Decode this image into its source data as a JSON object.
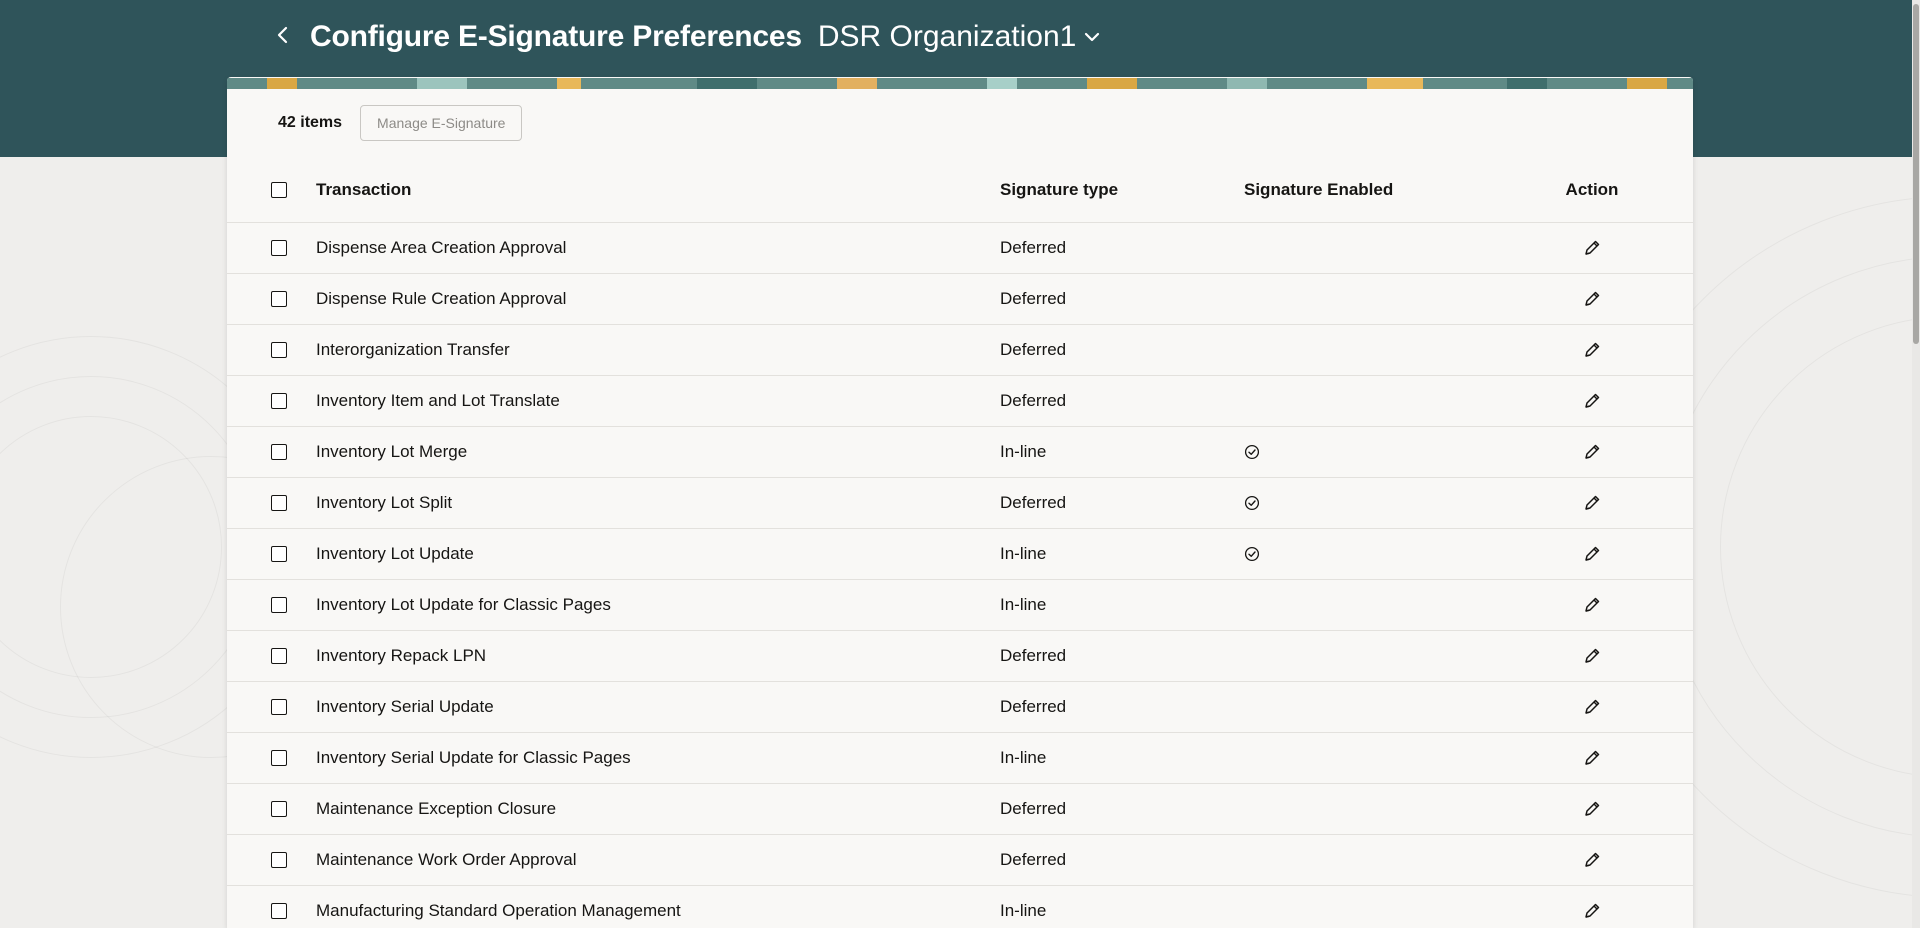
{
  "header": {
    "back_label": "Back",
    "title": "Configure E-Signature Preferences",
    "organization": "DSR Organization1",
    "colors": {
      "band": "#2f545a",
      "title_text": "#ffffff"
    }
  },
  "toolbar": {
    "items_count": "42 items",
    "manage_label": "Manage E-Signature"
  },
  "table": {
    "columns": {
      "transaction": "Transaction",
      "signature_type": "Signature type",
      "signature_enabled": "Signature Enabled",
      "action": "Action"
    },
    "rows": [
      {
        "transaction": "Dispense Area Creation Approval",
        "signature_type": "Deferred",
        "enabled": false
      },
      {
        "transaction": "Dispense Rule Creation Approval",
        "signature_type": "Deferred",
        "enabled": false
      },
      {
        "transaction": "Interorganization Transfer",
        "signature_type": "Deferred",
        "enabled": false
      },
      {
        "transaction": "Inventory Item and Lot Translate",
        "signature_type": "Deferred",
        "enabled": false
      },
      {
        "transaction": "Inventory Lot Merge",
        "signature_type": "In-line",
        "enabled": true
      },
      {
        "transaction": "Inventory Lot Split",
        "signature_type": "Deferred",
        "enabled": true
      },
      {
        "transaction": "Inventory Lot Update",
        "signature_type": "In-line",
        "enabled": true
      },
      {
        "transaction": "Inventory Lot Update for Classic Pages",
        "signature_type": "In-line",
        "enabled": false
      },
      {
        "transaction": "Inventory Repack LPN",
        "signature_type": "Deferred",
        "enabled": false
      },
      {
        "transaction": "Inventory Serial Update",
        "signature_type": "Deferred",
        "enabled": false
      },
      {
        "transaction": "Inventory Serial Update for Classic Pages",
        "signature_type": "In-line",
        "enabled": false
      },
      {
        "transaction": "Maintenance Exception Closure",
        "signature_type": "Deferred",
        "enabled": false
      },
      {
        "transaction": "Maintenance Work Order Approval",
        "signature_type": "Deferred",
        "enabled": false
      },
      {
        "transaction": "Manufacturing Standard Operation Management",
        "signature_type": "In-line",
        "enabled": false
      }
    ]
  },
  "icons": {
    "back": "chevron-left-icon",
    "org_dropdown": "chevron-down-icon",
    "enabled": "check-circle-icon",
    "edit": "pencil-icon"
  }
}
